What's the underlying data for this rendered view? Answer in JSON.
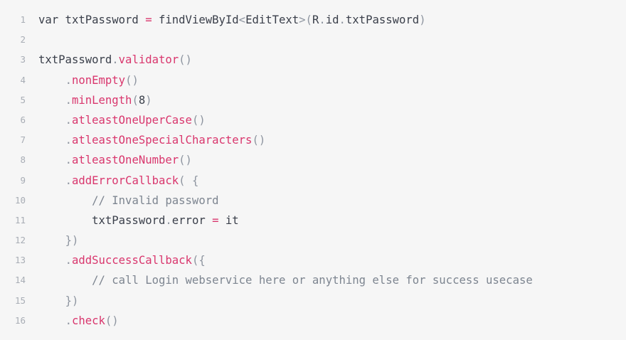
{
  "editor": {
    "lines": [
      {
        "number": "1",
        "tokens": [
          {
            "t": "var txtPassword ",
            "c": "plain"
          },
          {
            "t": "=",
            "c": "op"
          },
          {
            "t": " findViewById",
            "c": "plain"
          },
          {
            "t": "<",
            "c": "punc"
          },
          {
            "t": "EditText",
            "c": "plain"
          },
          {
            "t": ">(",
            "c": "punc"
          },
          {
            "t": "R",
            "c": "plain"
          },
          {
            "t": ".",
            "c": "punc"
          },
          {
            "t": "id",
            "c": "plain"
          },
          {
            "t": ".",
            "c": "punc"
          },
          {
            "t": "txtPassword",
            "c": "plain"
          },
          {
            "t": ")",
            "c": "punc"
          }
        ]
      },
      {
        "number": "2",
        "tokens": []
      },
      {
        "number": "3",
        "tokens": [
          {
            "t": "txtPassword",
            "c": "plain"
          },
          {
            "t": ".",
            "c": "punc"
          },
          {
            "t": "validator",
            "c": "fn"
          },
          {
            "t": "()",
            "c": "punc"
          }
        ]
      },
      {
        "number": "4",
        "tokens": [
          {
            "t": "    ",
            "c": "plain"
          },
          {
            "t": ".",
            "c": "punc"
          },
          {
            "t": "nonEmpty",
            "c": "fn"
          },
          {
            "t": "()",
            "c": "punc"
          }
        ]
      },
      {
        "number": "5",
        "tokens": [
          {
            "t": "    ",
            "c": "plain"
          },
          {
            "t": ".",
            "c": "punc"
          },
          {
            "t": "minLength",
            "c": "fn"
          },
          {
            "t": "(",
            "c": "punc"
          },
          {
            "t": "8",
            "c": "num"
          },
          {
            "t": ")",
            "c": "punc"
          }
        ]
      },
      {
        "number": "6",
        "tokens": [
          {
            "t": "    ",
            "c": "plain"
          },
          {
            "t": ".",
            "c": "punc"
          },
          {
            "t": "atleastOneUperCase",
            "c": "fn"
          },
          {
            "t": "()",
            "c": "punc"
          }
        ]
      },
      {
        "number": "7",
        "tokens": [
          {
            "t": "    ",
            "c": "plain"
          },
          {
            "t": ".",
            "c": "punc"
          },
          {
            "t": "atleastOneSpecialCharacters",
            "c": "fn"
          },
          {
            "t": "()",
            "c": "punc"
          }
        ]
      },
      {
        "number": "8",
        "tokens": [
          {
            "t": "    ",
            "c": "plain"
          },
          {
            "t": ".",
            "c": "punc"
          },
          {
            "t": "atleastOneNumber",
            "c": "fn"
          },
          {
            "t": "()",
            "c": "punc"
          }
        ]
      },
      {
        "number": "9",
        "tokens": [
          {
            "t": "    ",
            "c": "plain"
          },
          {
            "t": ".",
            "c": "punc"
          },
          {
            "t": "addErrorCallback",
            "c": "fn"
          },
          {
            "t": "( {",
            "c": "punc"
          }
        ]
      },
      {
        "number": "10",
        "tokens": [
          {
            "t": "        ",
            "c": "plain"
          },
          {
            "t": "// Invalid password",
            "c": "comment"
          }
        ]
      },
      {
        "number": "11",
        "tokens": [
          {
            "t": "        txtPassword",
            "c": "plain"
          },
          {
            "t": ".",
            "c": "punc"
          },
          {
            "t": "error ",
            "c": "plain"
          },
          {
            "t": "=",
            "c": "op"
          },
          {
            "t": " it",
            "c": "plain"
          }
        ]
      },
      {
        "number": "12",
        "tokens": [
          {
            "t": "    ",
            "c": "plain"
          },
          {
            "t": "})",
            "c": "punc"
          }
        ]
      },
      {
        "number": "13",
        "tokens": [
          {
            "t": "    ",
            "c": "plain"
          },
          {
            "t": ".",
            "c": "punc"
          },
          {
            "t": "addSuccessCallback",
            "c": "fn"
          },
          {
            "t": "({",
            "c": "punc"
          }
        ]
      },
      {
        "number": "14",
        "tokens": [
          {
            "t": "        ",
            "c": "plain"
          },
          {
            "t": "// call Login webservice here or anything else for success usecase",
            "c": "comment"
          }
        ]
      },
      {
        "number": "15",
        "tokens": [
          {
            "t": "    ",
            "c": "plain"
          },
          {
            "t": "})",
            "c": "punc"
          }
        ]
      },
      {
        "number": "16",
        "tokens": [
          {
            "t": "    ",
            "c": "plain"
          },
          {
            "t": ".",
            "c": "punc"
          },
          {
            "t": "check",
            "c": "fn"
          },
          {
            "t": "()",
            "c": "punc"
          }
        ]
      }
    ]
  },
  "colors": {
    "background": "#f6f6f6",
    "plain": "#3a3f4a",
    "accent": "#d9366d",
    "punctuation": "#8e95a0",
    "line_number": "#a8adb5",
    "comment": "#7d8590"
  }
}
